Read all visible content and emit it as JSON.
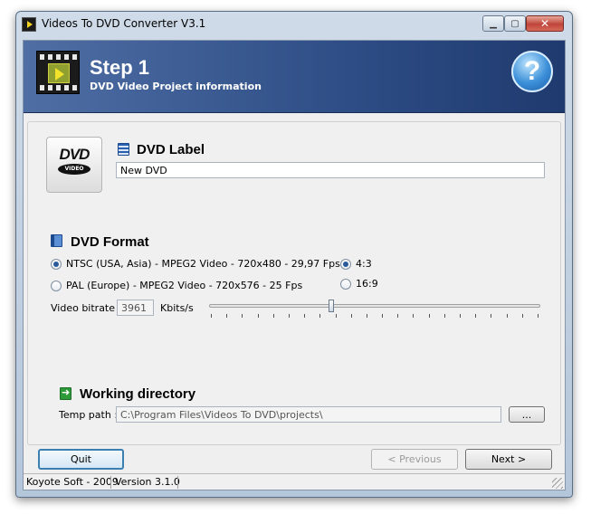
{
  "window": {
    "title": "Videos To DVD Converter V3.1"
  },
  "banner": {
    "step": "Step 1",
    "subtitle": "DVD Video Project information"
  },
  "label_section": {
    "title": "DVD Label",
    "value": "New DVD"
  },
  "format_section": {
    "title": "DVD Format",
    "standards": [
      {
        "label": "NTSC (USA, Asia) - MPEG2 Video - 720x480 - 29,97 Fps",
        "selected": true
      },
      {
        "label": "PAL (Europe) - MPEG2 Video - 720x576 - 25 Fps",
        "selected": false
      }
    ],
    "aspects": [
      {
        "label": "4:3",
        "selected": true
      },
      {
        "label": "16:9",
        "selected": false
      }
    ],
    "bitrate_label": "Video bitrate",
    "bitrate_value": "3961",
    "bitrate_unit": "Kbits/s",
    "bitrate_slider_fraction": 0.37
  },
  "directory_section": {
    "title": "Working directory",
    "temp_label": "Temp path :",
    "temp_value": "C:\\Program Files\\Videos To DVD\\projects\\",
    "browse_label": "..."
  },
  "buttons": {
    "quit": "Quit",
    "previous": "< Previous",
    "next": "Next >"
  },
  "status": {
    "company": "Koyote Soft - 2009",
    "version": "Version 3.1.0"
  }
}
